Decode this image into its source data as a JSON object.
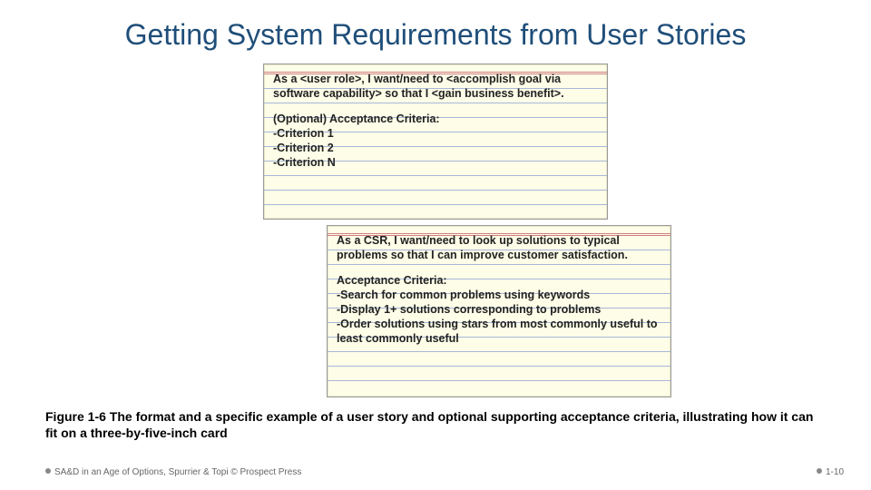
{
  "title": "Getting System Requirements from User Stories",
  "card1": {
    "story": "As a <user role>, I want/need to <accomplish goal via software capability> so that I <gain business benefit>.",
    "opt_label": "(Optional) Acceptance Criteria:",
    "c1": "-Criterion 1",
    "c2": "-Criterion 2",
    "c3": "-Criterion N"
  },
  "card2": {
    "story": "As a CSR, I want/need to look up solutions to typical problems so that I can improve customer satisfaction.",
    "ac_label": "Acceptance Criteria:",
    "c1": "-Search for common problems using keywords",
    "c2": "-Display 1+ solutions corresponding to problems",
    "c3": "-Order solutions using stars from most commonly useful to least commonly useful"
  },
  "caption": "Figure 1-6 The format and a specific example of a user story and optional supporting acceptance criteria, illustrating how it can fit on a three-by-five-inch card",
  "footer_left": "SA&D in an Age of Options, Spurrier & Topi © Prospect Press",
  "footer_right": "1-10"
}
